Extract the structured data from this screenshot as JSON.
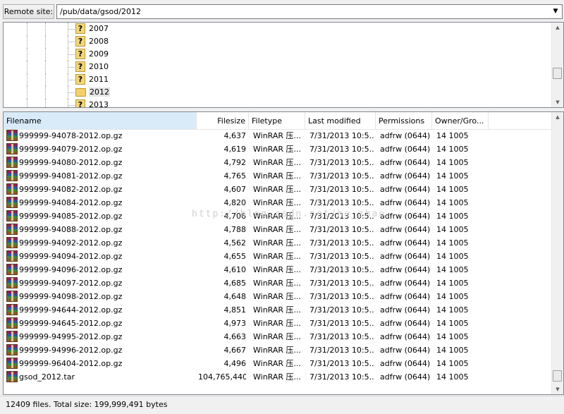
{
  "remote": {
    "label": "Remote site:",
    "path": "/pub/data/gsod/2012",
    "dropdown_icon": "chevron-down-icon"
  },
  "tree": {
    "items": [
      {
        "label": "2007",
        "icon": "question-folder-icon"
      },
      {
        "label": "2008",
        "icon": "question-folder-icon"
      },
      {
        "label": "2009",
        "icon": "question-folder-icon"
      },
      {
        "label": "2010",
        "icon": "question-folder-icon"
      },
      {
        "label": "2011",
        "icon": "question-folder-icon"
      },
      {
        "label": "2012",
        "icon": "open-folder-icon",
        "selected": true
      },
      {
        "label": "2013",
        "icon": "question-folder-icon"
      }
    ]
  },
  "list": {
    "columns": {
      "filename": "Filename",
      "filesize": "Filesize",
      "filetype": "Filetype",
      "modified": "Last modified",
      "permissions": "Permissions",
      "owner": "Owner/Gro..."
    },
    "sort": {
      "column": "filename",
      "direction": "ascending"
    },
    "rows": [
      {
        "name": "999999-94078-2012.op.gz",
        "size": "4,637",
        "type": "WinRAR 压...",
        "modified": "7/31/2013 10:5...",
        "perm": "adfrw (0644)",
        "owner": "14 1005"
      },
      {
        "name": "999999-94079-2012.op.gz",
        "size": "4,619",
        "type": "WinRAR 压...",
        "modified": "7/31/2013 10:5...",
        "perm": "adfrw (0644)",
        "owner": "14 1005"
      },
      {
        "name": "999999-94080-2012.op.gz",
        "size": "4,792",
        "type": "WinRAR 压...",
        "modified": "7/31/2013 10:5...",
        "perm": "adfrw (0644)",
        "owner": "14 1005"
      },
      {
        "name": "999999-94081-2012.op.gz",
        "size": "4,765",
        "type": "WinRAR 压...",
        "modified": "7/31/2013 10:5...",
        "perm": "adfrw (0644)",
        "owner": "14 1005"
      },
      {
        "name": "999999-94082-2012.op.gz",
        "size": "4,607",
        "type": "WinRAR 压...",
        "modified": "7/31/2013 10:5...",
        "perm": "adfrw (0644)",
        "owner": "14 1005"
      },
      {
        "name": "999999-94084-2012.op.gz",
        "size": "4,820",
        "type": "WinRAR 压...",
        "modified": "7/31/2013 10:5...",
        "perm": "adfrw (0644)",
        "owner": "14 1005"
      },
      {
        "name": "999999-94085-2012.op.gz",
        "size": "4,706",
        "type": "WinRAR 压...",
        "modified": "7/31/2013 10:5...",
        "perm": "adfrw (0644)",
        "owner": "14 1005"
      },
      {
        "name": "999999-94088-2012.op.gz",
        "size": "4,788",
        "type": "WinRAR 压...",
        "modified": "7/31/2013 10:5...",
        "perm": "adfrw (0644)",
        "owner": "14 1005"
      },
      {
        "name": "999999-94092-2012.op.gz",
        "size": "4,562",
        "type": "WinRAR 压...",
        "modified": "7/31/2013 10:5...",
        "perm": "adfrw (0644)",
        "owner": "14 1005"
      },
      {
        "name": "999999-94094-2012.op.gz",
        "size": "4,655",
        "type": "WinRAR 压...",
        "modified": "7/31/2013 10:5...",
        "perm": "adfrw (0644)",
        "owner": "14 1005"
      },
      {
        "name": "999999-94096-2012.op.gz",
        "size": "4,610",
        "type": "WinRAR 压...",
        "modified": "7/31/2013 10:5...",
        "perm": "adfrw (0644)",
        "owner": "14 1005"
      },
      {
        "name": "999999-94097-2012.op.gz",
        "size": "4,685",
        "type": "WinRAR 压...",
        "modified": "7/31/2013 10:5...",
        "perm": "adfrw (0644)",
        "owner": "14 1005"
      },
      {
        "name": "999999-94098-2012.op.gz",
        "size": "4,648",
        "type": "WinRAR 压...",
        "modified": "7/31/2013 10:5...",
        "perm": "adfrw (0644)",
        "owner": "14 1005"
      },
      {
        "name": "999999-94644-2012.op.gz",
        "size": "4,851",
        "type": "WinRAR 压...",
        "modified": "7/31/2013 10:5...",
        "perm": "adfrw (0644)",
        "owner": "14 1005"
      },
      {
        "name": "999999-94645-2012.op.gz",
        "size": "4,973",
        "type": "WinRAR 压...",
        "modified": "7/31/2013 10:5...",
        "perm": "adfrw (0644)",
        "owner": "14 1005"
      },
      {
        "name": "999999-94995-2012.op.gz",
        "size": "4,663",
        "type": "WinRAR 压...",
        "modified": "7/31/2013 10:5...",
        "perm": "adfrw (0644)",
        "owner": "14 1005"
      },
      {
        "name": "999999-94996-2012.op.gz",
        "size": "4,667",
        "type": "WinRAR 压...",
        "modified": "7/31/2013 10:5...",
        "perm": "adfrw (0644)",
        "owner": "14 1005"
      },
      {
        "name": "999999-96404-2012.op.gz",
        "size": "4,496",
        "type": "WinRAR 压...",
        "modified": "7/31/2013 10:5...",
        "perm": "adfrw (0644)",
        "owner": "14 1005"
      },
      {
        "name": "gsod_2012.tar",
        "size": "104,765,440",
        "type": "WinRAR 压...",
        "modified": "7/31/2013 10:5...",
        "perm": "adfrw (0644)",
        "owner": "14 1005"
      }
    ]
  },
  "status": {
    "text": "12409 files. Total size: 199,999,491 bytes"
  },
  "watermark": "http://blog.csdn.net/ha_zhao",
  "colors": {
    "selection_header": "#d9ebf9",
    "folder": "#f2d06b"
  }
}
